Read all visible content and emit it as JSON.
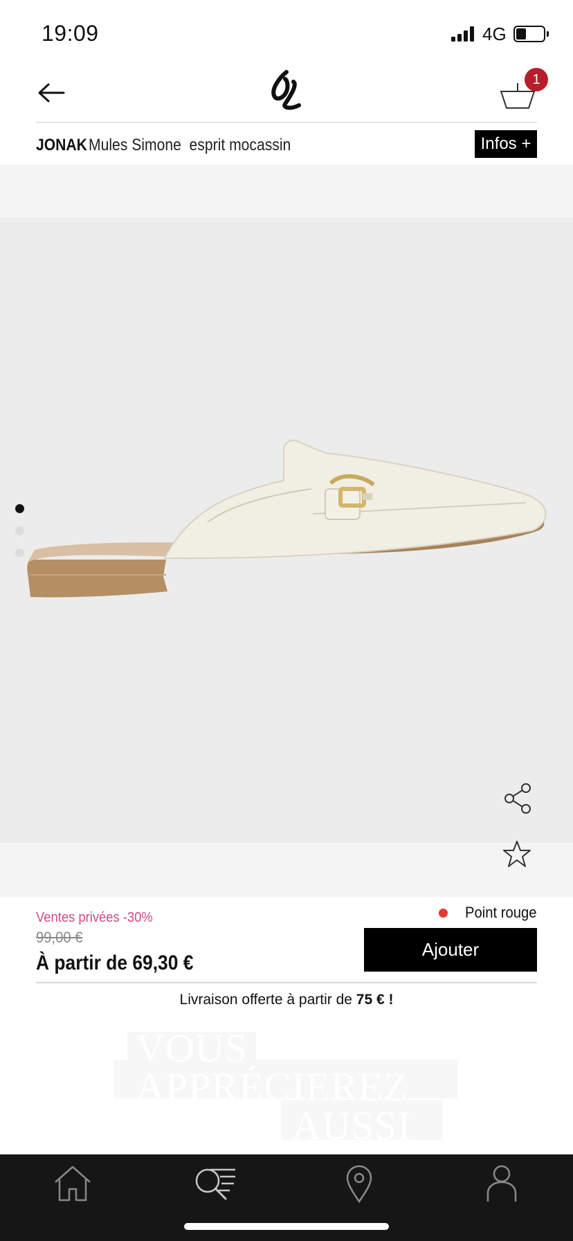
{
  "status_bar": {
    "time": "19:09",
    "network": "4G"
  },
  "header": {
    "cart_count": "1"
  },
  "product": {
    "brand": "JONAK",
    "name": "Mules Simone  esprit mocassin",
    "infos_label": "Infos +"
  },
  "gallery": {
    "image_count": 3,
    "active_index": 0
  },
  "purchase": {
    "sale_label": "Ventes privées -30%",
    "old_price": "99,00 €",
    "price": "À partir de 69,30 €",
    "color_name": "Point rouge",
    "add_label": "Ajouter",
    "delivery_prefix": "Livraison offerte à partir de ",
    "delivery_amount": "75 € !"
  },
  "recommendations": {
    "heading_line1": "VOUS",
    "heading_line2": "APPRÉCIEREZ",
    "heading_line3": "AUSSI"
  },
  "tab_bar": {
    "items": [
      "home-icon",
      "search-icon",
      "location-icon",
      "account-icon"
    ]
  },
  "colors": {
    "accent_pink": "#d14a87",
    "badge_red": "#b71d2b",
    "color_dot_red": "#e23a2e",
    "gallery_background": "#ececec",
    "tab_bar_background": "#161616"
  }
}
